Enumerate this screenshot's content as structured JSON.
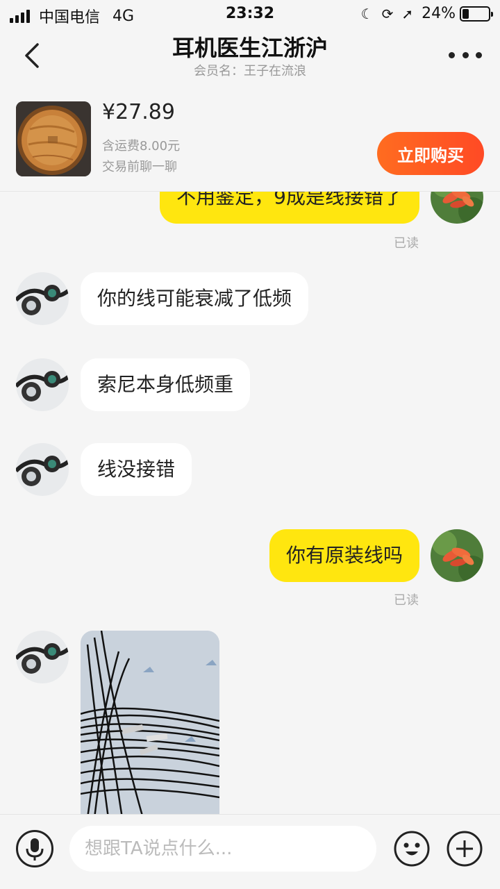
{
  "status_bar": {
    "carrier": "中国电信",
    "network": "4G",
    "time": "23:32",
    "battery": "24%",
    "battery_level": 0.24
  },
  "nav": {
    "title": "耳机医生江浙沪",
    "subtitle": "会员名：王子在流浪"
  },
  "product": {
    "price": "¥27.89",
    "shipping": "含运费8.00元",
    "hint": "交易前聊一聊",
    "buy_label": "立即购买"
  },
  "messages": [
    {
      "side": "me",
      "text": "不用鉴定，9成是线接错了",
      "read": "已读"
    },
    {
      "side": "them",
      "text": "你的线可能衰减了低频"
    },
    {
      "side": "them",
      "text": "索尼本身低频重"
    },
    {
      "side": "them",
      "text": "线没接错"
    },
    {
      "side": "me",
      "text": "你有原装线吗",
      "read": "已读"
    },
    {
      "side": "them",
      "type": "image"
    }
  ],
  "input": {
    "placeholder": "想跟TA说点什么..."
  },
  "colors": {
    "my_bubble": "#ffe60f",
    "their_bubble": "#ffffff",
    "buy_button": "#ff5a22"
  }
}
